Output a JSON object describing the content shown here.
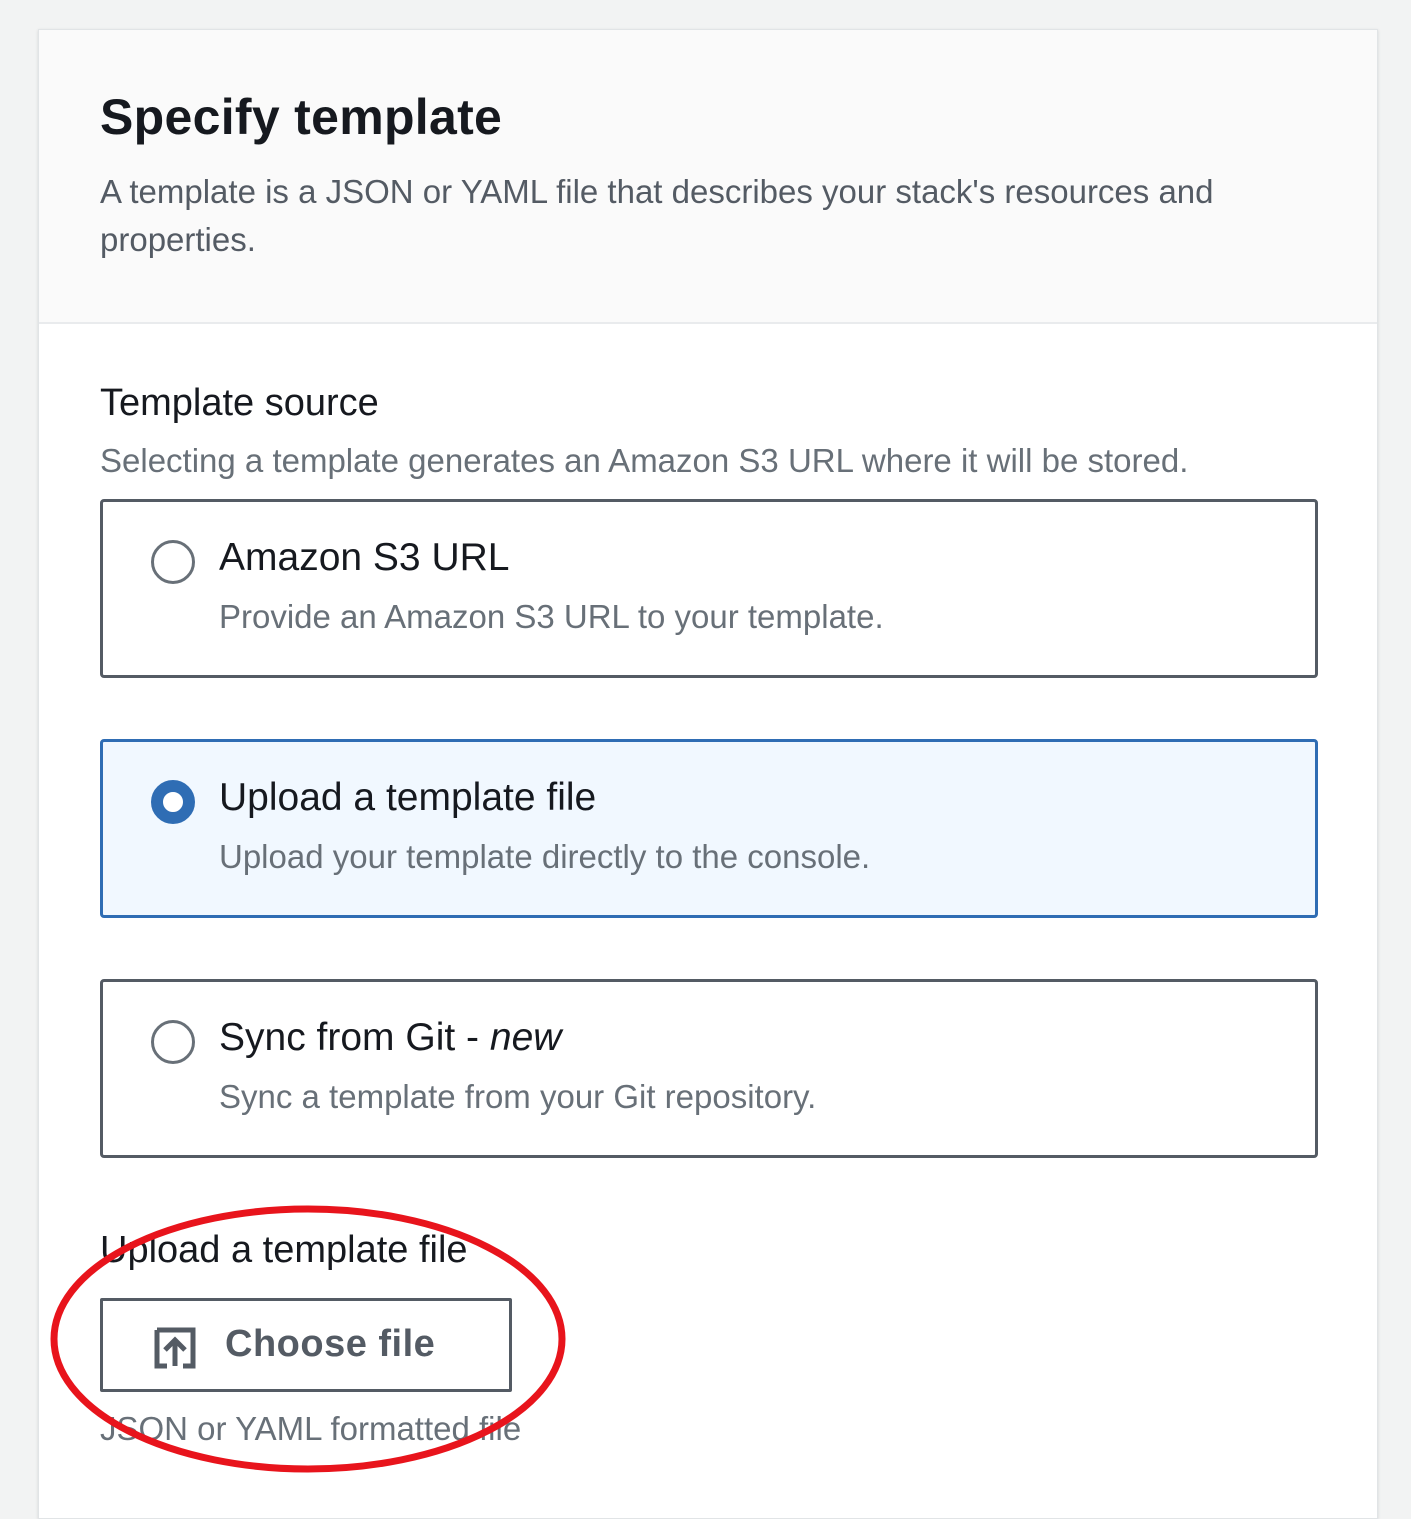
{
  "header": {
    "title": "Specify template",
    "description": "A template is a JSON or YAML file that describes your stack's resources and properties."
  },
  "template_source": {
    "label": "Template source",
    "description": "Selecting a template generates an Amazon S3 URL where it will be stored.",
    "options": [
      {
        "label": "Amazon S3 URL",
        "suffix": "",
        "description": "Provide an Amazon S3 URL to your template.",
        "selected": false
      },
      {
        "label": "Upload a template file",
        "suffix": "",
        "description": "Upload your template directly to the console.",
        "selected": true
      },
      {
        "label": "Sync from Git - ",
        "suffix": "new",
        "description": "Sync a template from your Git repository.",
        "selected": false
      }
    ]
  },
  "upload": {
    "label": "Upload a template file",
    "button_label": "Choose file",
    "button_icon": "upload-icon",
    "hint": "JSON or YAML formatted file"
  },
  "colors": {
    "accent": "#2f6db4",
    "annotation": "#e8141c",
    "selected_bg": "#f1f8ff"
  }
}
